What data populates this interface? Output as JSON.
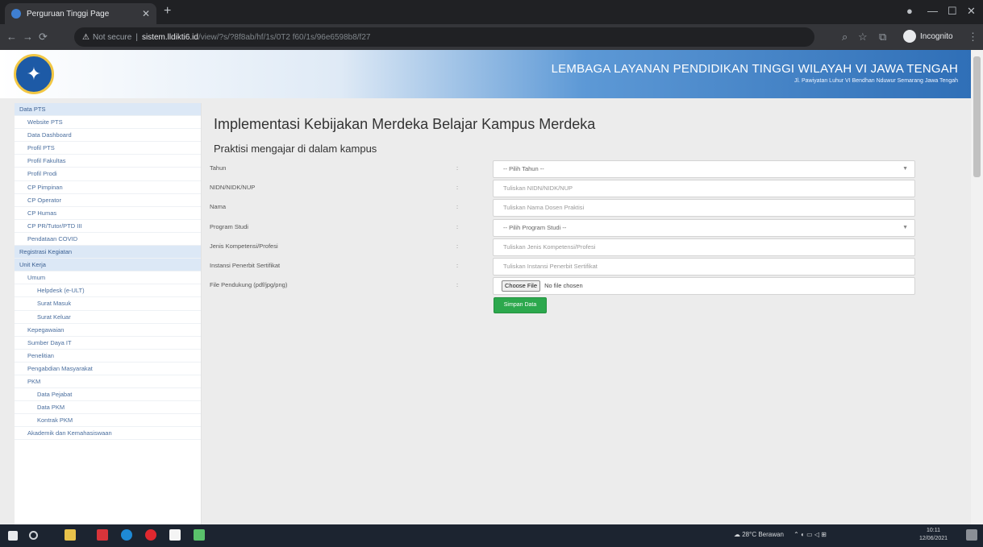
{
  "browser": {
    "tab_title": "Perguruan Tinggi Page",
    "address_warning": "Not secure",
    "url_host": "sistem.lldikti6.id",
    "url_path": "/view/?s/?8f8ab/hf/1s/0T2 f60/1s/96e6598b8/f27",
    "profile_label": "Incognito",
    "icons": [
      "back-icon",
      "forward-icon",
      "reload-icon",
      "search-icon",
      "star-icon",
      "extensions-icon",
      "menu-icon"
    ]
  },
  "banner": {
    "title": "LEMBAGA LAYANAN PENDIDIKAN TINGGI WILAYAH VI JAWA TENGAH",
    "subtitle": "Jl. Pawiyatan Luhur VI Bendhan Nduwur Semarang Jawa Tengah"
  },
  "sidebar": {
    "items": [
      {
        "label": "Data PTS",
        "level": 0,
        "highlight": true
      },
      {
        "label": "Website PTS",
        "level": 1
      },
      {
        "label": "Data Dashboard",
        "level": 1
      },
      {
        "label": "Profil PTS",
        "level": 1
      },
      {
        "label": "Profil Fakultas",
        "level": 1
      },
      {
        "label": "Profil Prodi",
        "level": 1
      },
      {
        "label": "CP Pimpinan",
        "level": 1
      },
      {
        "label": "CP Operator",
        "level": 1
      },
      {
        "label": "CP Humas",
        "level": 1
      },
      {
        "label": "CP PR/Tutor/PTD III",
        "level": 1
      },
      {
        "label": "Pendataan COVID",
        "level": 1
      },
      {
        "label": "Registrasi Kegiatan",
        "level": 0,
        "highlight": true
      },
      {
        "label": "Unit Kerja",
        "level": 0,
        "highlight": true
      },
      {
        "label": "Umum",
        "level": 1
      },
      {
        "label": "Helpdesk (e-ULT)",
        "level": 2
      },
      {
        "label": "Surat Masuk",
        "level": 2
      },
      {
        "label": "Surat Keluar",
        "level": 2
      },
      {
        "label": "Kepegawaian",
        "level": 1
      },
      {
        "label": "Sumber Daya IT",
        "level": 1
      },
      {
        "label": "Penelitian",
        "level": 1
      },
      {
        "label": "Pengabdian Masyarakat",
        "level": 1
      },
      {
        "label": "PKM",
        "level": 1
      },
      {
        "label": "Data Pejabat",
        "level": 2
      },
      {
        "label": "Data PKM",
        "level": 2
      },
      {
        "label": "Kontrak PKM",
        "level": 2
      },
      {
        "label": "Akademik dan Kemahasiswaan",
        "level": 1
      }
    ]
  },
  "main": {
    "title": "Implementasi Kebijakan Merdeka Belajar Kampus Merdeka",
    "subtitle": "Praktisi mengajar di dalam kampus",
    "colon": ":",
    "form": {
      "tahun": {
        "label": "Tahun",
        "value": "-- Pilih Tahun --"
      },
      "nidn": {
        "label": "NIDN/NIDK/NUP",
        "placeholder": "Tuliskan NIDN/NIDK/NUP"
      },
      "nama": {
        "label": "Nama",
        "placeholder": "Tuliskan Nama Dosen Praktisi"
      },
      "prodi": {
        "label": "Program Studi",
        "value": "-- Pilih Program Studi --"
      },
      "kompetensi": {
        "label": "Jenis Kompetensi/Profesi",
        "placeholder": "Tuliskan Jenis Kompetensi/Profesi"
      },
      "instansi": {
        "label": "Instansi Penerbit Sertifikat",
        "placeholder": "Tuliskan Instansi Penerbit Sertifikat"
      },
      "file": {
        "label": "File Pendukung (pdf/jpg/png)",
        "button": "Choose File",
        "status": "No file chosen"
      }
    },
    "submit_label": "Simpan Data"
  },
  "taskbar": {
    "weather": "28°C Berawan",
    "time": "10:11",
    "date": "12/06/2021"
  },
  "colors": {
    "accent": "#2ca84d",
    "banner_blue": "#2f6fb7",
    "sidebar_link": "#4a6e9e"
  }
}
